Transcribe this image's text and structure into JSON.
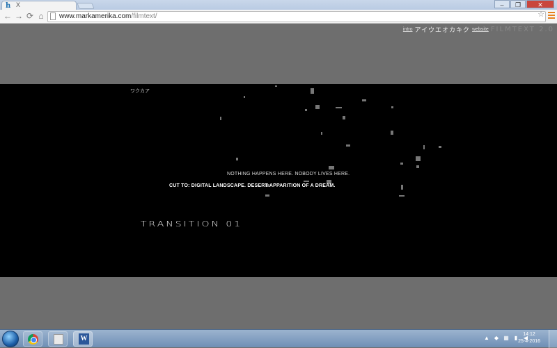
{
  "browser": {
    "tab": {
      "favicon": "h",
      "close_label": "X"
    },
    "window_controls": {
      "minimize": "–",
      "maximize": "❐",
      "close": "✕"
    },
    "nav": {
      "back": "←",
      "forward": "→",
      "reload": "⟳",
      "home": "⌂"
    },
    "url": {
      "host": "www.markamerika.com",
      "path": "/filmtext/"
    },
    "icons": {
      "bookmark": "star-icon",
      "menu": "hamburger-menu-icon"
    }
  },
  "site": {
    "nav": {
      "intro_label": "intro",
      "kana": "アイウエオカキク",
      "website_label": "website",
      "brand": "FILMTEXT 2.0"
    },
    "film": {
      "corner_text": "ワクカア",
      "line1": "NOTHING HAPPENS HERE. NOBODY LIVES HERE.",
      "line2": "CUT TO: DIGITAL LANDSCAPE.  DESERT APPARITION OF A DREAM.",
      "title": "TRANSITION 01"
    }
  },
  "taskbar": {
    "apps": [
      {
        "name": "Google Chrome",
        "icon": "chrome-icon"
      },
      {
        "name": "Windows Explorer",
        "icon": "explorer-icon"
      },
      {
        "name": "Microsoft Word",
        "icon": "word-icon",
        "glyph": "W"
      }
    ],
    "clock": {
      "time": "14:12",
      "date": "25-4-2016"
    }
  }
}
